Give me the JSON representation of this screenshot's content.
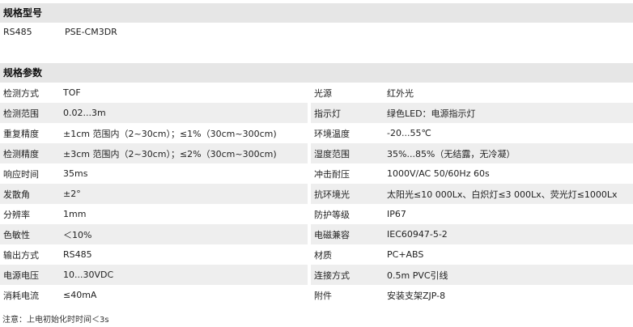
{
  "model_section": {
    "title": "规格型号",
    "row": {
      "key": "RS485",
      "value": "PSE-CM3DR"
    }
  },
  "params_section": {
    "title": "规格参数",
    "rows": [
      {
        "l_label": "检测方式",
        "l_value": "TOF",
        "r_label": "光源",
        "r_value": "红外光"
      },
      {
        "l_label": "检测范围",
        "l_value": "0.02...3m",
        "r_label": "指示灯",
        "r_value": "绿色LED：电源指示灯"
      },
      {
        "l_label": "重复精度",
        "l_value": "±1cm 范围内（2~30cm）；≤1%（30cm~300cm)",
        "r_label": "环境温度",
        "r_value": "-20...55℃"
      },
      {
        "l_label": "检测精度",
        "l_value": "±3cm 范围内（2~30cm）；≤2%（30cm~300cm)",
        "r_label": "湿度范围",
        "r_value": "35%...85%（无结露，无冷凝）"
      },
      {
        "l_label": "响应时间",
        "l_value": "35ms",
        "r_label": "冲击耐压",
        "r_value": "1000V/AC 50/60Hz 60s"
      },
      {
        "l_label": "发散角",
        "l_value": "±2°",
        "r_label": "抗环境光",
        "r_value": "太阳光≤10 000Lx、白炽灯≤3 000Lx、荧光灯≤1000Lx"
      },
      {
        "l_label": "分辨率",
        "l_value": "1mm",
        "r_label": "防护等级",
        "r_value": "IP67"
      },
      {
        "l_label": "色敏性",
        "l_value": "＜10%",
        "r_label": "电磁兼容",
        "r_value": "IEC60947-5-2"
      },
      {
        "l_label": "输出方式",
        "l_value": "RS485",
        "r_label": "材质",
        "r_value": "PC+ABS"
      },
      {
        "l_label": "电源电压",
        "l_value": "10...30VDC",
        "r_label": "连接方式",
        "r_value": "0.5m PVC引线"
      },
      {
        "l_label": "消耗电流",
        "l_value": "≤40mA",
        "r_label": "附件",
        "r_value": "安装支架ZJP-8"
      }
    ]
  },
  "note": "注意：上电初始化时时间＜3s"
}
